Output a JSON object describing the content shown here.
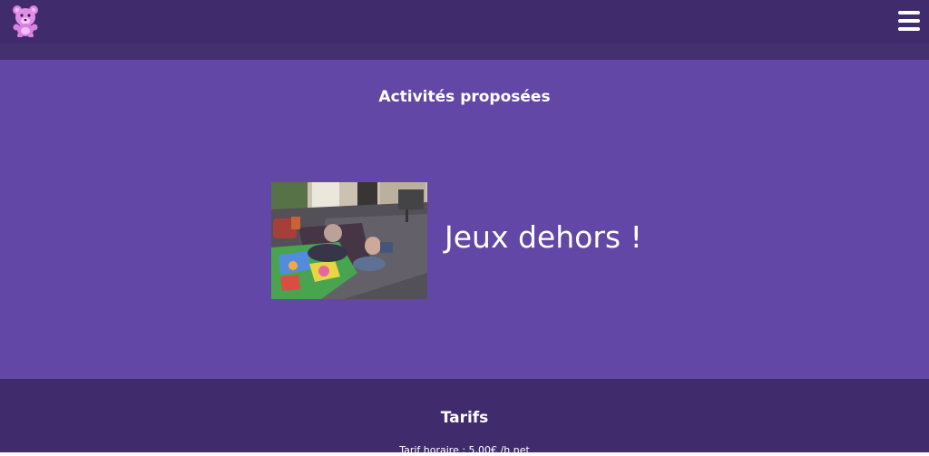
{
  "header": {
    "logo_icon": "teddy-bear-icon",
    "menu_icon": "hamburger-menu-icon",
    "colors": {
      "bar": "#402b6d"
    }
  },
  "activities": {
    "title": "Activités proposées",
    "items": [
      {
        "caption": "Jeux dehors !",
        "photo": "children-playing-on-mat-photo"
      }
    ],
    "colors": {
      "background": "#6247a6"
    }
  },
  "tarifs": {
    "title": "Tarifs",
    "hourly_rate": "Tarif horaire : 5,00€ /h net",
    "colors": {
      "background": "#402b6d"
    }
  }
}
